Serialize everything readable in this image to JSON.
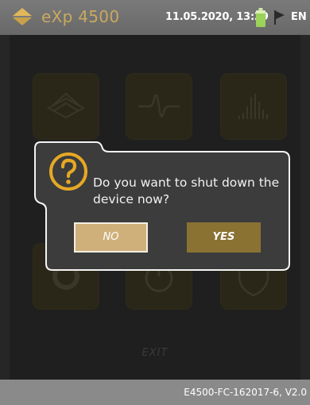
{
  "statusbar": {
    "app_name": "eXp 4500",
    "datetime": "11.05.2020, 13:29",
    "language": "EN",
    "battery_icon": "battery-icon",
    "flag_icon": "flag-icon",
    "logo_icon": "device-logo-icon"
  },
  "menu": {
    "tiles": [
      {
        "icon": "ground-scan-icon"
      },
      {
        "icon": "waveform-icon"
      },
      {
        "icon": "spectrum-icon"
      },
      {
        "icon": "settings-gear-icon"
      },
      {
        "icon": "power-icon"
      },
      {
        "icon": "shield-icon"
      }
    ],
    "exit_label": "EXIT"
  },
  "dialog": {
    "icon": "question-icon",
    "message": "Do you want to shut down the device now?",
    "no_label": "NO",
    "yes_label": "YES"
  },
  "footer": {
    "version": "E4500-FC-162017-6, V2.0"
  },
  "colors": {
    "accent_gold": "#c9a95e",
    "no_button": "#cfb07a",
    "yes_button": "#8a7233",
    "battery_green": "#9bd35a"
  }
}
